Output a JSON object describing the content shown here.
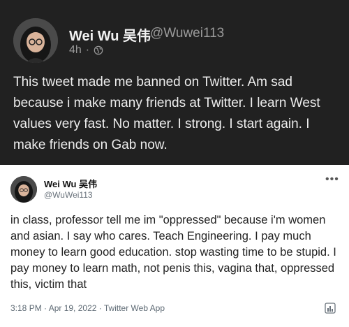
{
  "gab_post": {
    "display_name": "Wei Wu 吴伟",
    "handle": "@Wuwei113",
    "time_ago": "4h",
    "separator": "·",
    "visibility_icon": "globe-icon",
    "text": "This tweet made me banned on Twitter. Am sad because i make many friends at Twitter. I learn West values very fast. No matter. I strong. I start again. I make friends on Gab now."
  },
  "embedded_tweet": {
    "display_name": "Wei Wu 吴伟",
    "handle": "@WuWei113",
    "more_icon": "more-icon",
    "text": "in class, professor tell me im \"oppressed\" because i'm women and asian. I say who cares. Teach Engineering. I pay much money to learn good education. stop wasting time to be stupid. I pay money to learn math, not penis this, vagina that, oppressed this, victim that",
    "meta": "3:18 PM · Apr 19, 2022 · Twitter Web App",
    "analytics_icon": "analytics-icon"
  },
  "colors": {
    "gab_background": "#212121",
    "tweet_background": "#ffffff"
  }
}
